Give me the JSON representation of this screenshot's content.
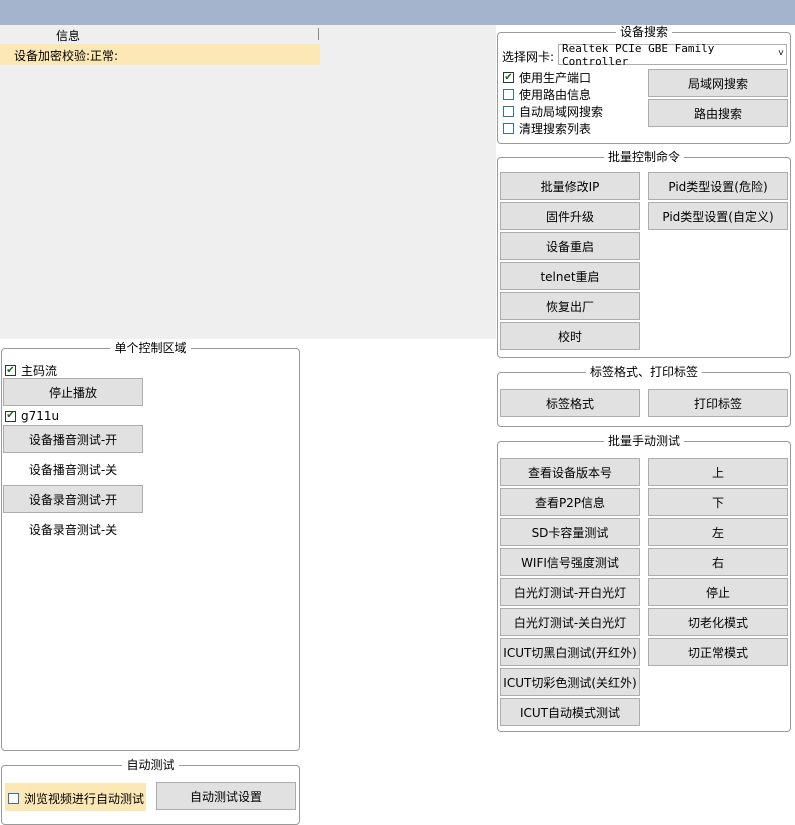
{
  "info": {
    "header": "信息",
    "row": "设备加密校验:正常:"
  },
  "device_search": {
    "title": "设备搜索",
    "nic_label": "选择网卡:",
    "nic_value": "Realtek PCIe GBE Family Controller",
    "checks": [
      {
        "label": "使用生产端口",
        "checked": true
      },
      {
        "label": "使用路由信息",
        "checked": false
      },
      {
        "label": "自动局域网搜索",
        "checked": false
      },
      {
        "label": "清理搜索列表",
        "checked": false
      }
    ],
    "lan_search": "局域网搜索",
    "route_search": "路由搜索"
  },
  "batch_control": {
    "title": "批量控制命令",
    "left": [
      "批量修改IP",
      "固件升级",
      "设备重启",
      "telnet重启",
      "恢复出厂",
      "校时"
    ],
    "right": [
      "Pid类型设置(危险)",
      "Pid类型设置(自定义)"
    ]
  },
  "label_print": {
    "title": "标签格式、打印标签",
    "format": "标签格式",
    "print": "打印标签"
  },
  "batch_manual": {
    "title": "批量手动测试",
    "left": [
      "查看设备版本号",
      "查看P2P信息",
      "SD卡容量测试",
      "WIFI信号强度测试",
      "白光灯测试-开白光灯",
      "白光灯测试-关白光灯",
      "ICUT切黑白测试(开红外)",
      "ICUT切彩色测试(关红外)",
      "ICUT自动模式测试"
    ],
    "right": [
      "上",
      "下",
      "左",
      "右",
      "停止",
      "切老化模式",
      "切正常模式"
    ]
  },
  "single_control": {
    "title": "单个控制区域",
    "main_stream": "主码流",
    "stop_play": "停止播放",
    "g711u": "g711u",
    "play_test_on": "设备播音测试-开",
    "play_test_off": "设备播音测试-关",
    "record_test_on": "设备录音测试-开",
    "record_test_off": "设备录音测试-关"
  },
  "auto_test": {
    "title": "自动测试",
    "browse_check": "浏览视频进行自动测试",
    "settings": "自动测试设置"
  }
}
